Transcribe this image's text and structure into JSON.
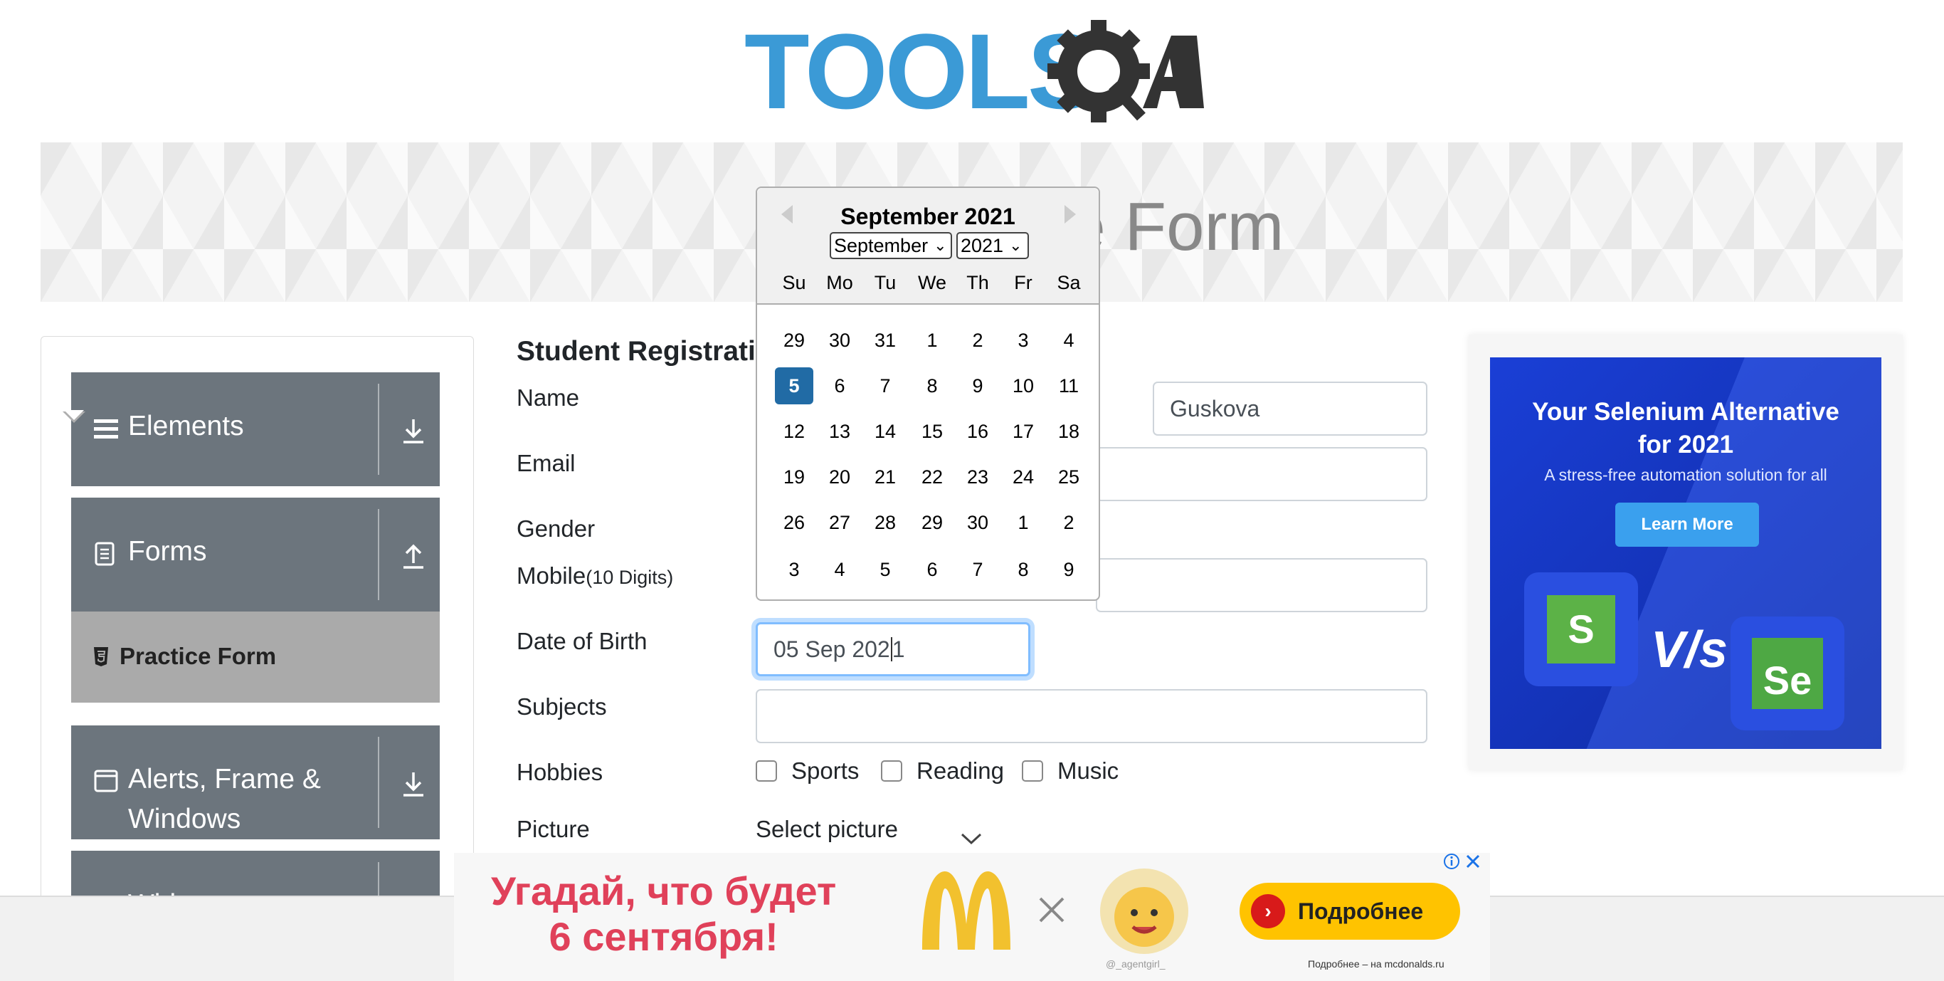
{
  "header": {
    "logo_text": "TOOLSQA"
  },
  "banner": {
    "title": "Practice Form"
  },
  "sidebar": {
    "groups": [
      {
        "label": "Elements",
        "icon": "hamburger-icon",
        "arrow": "download-icon"
      },
      {
        "label": "Forms",
        "icon": "document-icon",
        "arrow": "upload-icon"
      },
      {
        "label": "Alerts, Frame &",
        "label_line2": "Windows",
        "icon": "window-icon",
        "arrow": "download-icon"
      },
      {
        "label": "Widgets",
        "icon": "widget-icon",
        "arrow": "download-icon"
      }
    ],
    "active_item": {
      "label": "Practice Form",
      "icon": "html-icon"
    }
  },
  "form": {
    "heading": "Student Registratic",
    "labels": {
      "name": "Name",
      "email": "Email",
      "gender": "Gender",
      "mobile": "Mobile",
      "mobile_hint": "(10 Digits)",
      "dob": "Date of Birth",
      "subjects": "Subjects",
      "hobbies": "Hobbies",
      "picture": "Picture"
    },
    "last_name_value": "Guskova",
    "dob_value": "05 Sep 202",
    "dob_value_tail": "1",
    "hobbies": [
      "Sports",
      "Reading",
      "Music"
    ],
    "picture_label": "Select picture"
  },
  "datepicker": {
    "current_month": "September 2021",
    "month_select": "September",
    "year_select": "2021",
    "weekdays": [
      "Su",
      "Mo",
      "Tu",
      "We",
      "Th",
      "Fr",
      "Sa"
    ],
    "weeks": [
      [
        "29",
        "30",
        "31",
        "1",
        "2",
        "3",
        "4"
      ],
      [
        "5",
        "6",
        "7",
        "8",
        "9",
        "10",
        "11"
      ],
      [
        "12",
        "13",
        "14",
        "15",
        "16",
        "17",
        "18"
      ],
      [
        "19",
        "20",
        "21",
        "22",
        "23",
        "24",
        "25"
      ],
      [
        "26",
        "27",
        "28",
        "29",
        "30",
        "1",
        "2"
      ],
      [
        "3",
        "4",
        "5",
        "6",
        "7",
        "8",
        "9"
      ]
    ],
    "selected_day": "5"
  },
  "right_ad": {
    "headline_line1": "Your Selenium Alternative",
    "headline_line2": "for 2021",
    "subtitle": "A stress-free automation solution for all",
    "button": "Learn More",
    "vs": "V/s",
    "logo_left": "S",
    "logo_right": "Se"
  },
  "bottom_ad": {
    "text_line1": "Угадай, что будет",
    "text_line2": "6 сентября!",
    "button": "Подробнее",
    "handle": "@_agentgirl_",
    "small": "Подробнее – на mcdonalds.ru"
  },
  "colors": {
    "sidebar_group": "#6c757d",
    "sidebar_active": "#aaaaaa",
    "selected_day": "#216ba5",
    "focus_border": "#80bdff",
    "ad_blue": "#1a3fd6"
  }
}
